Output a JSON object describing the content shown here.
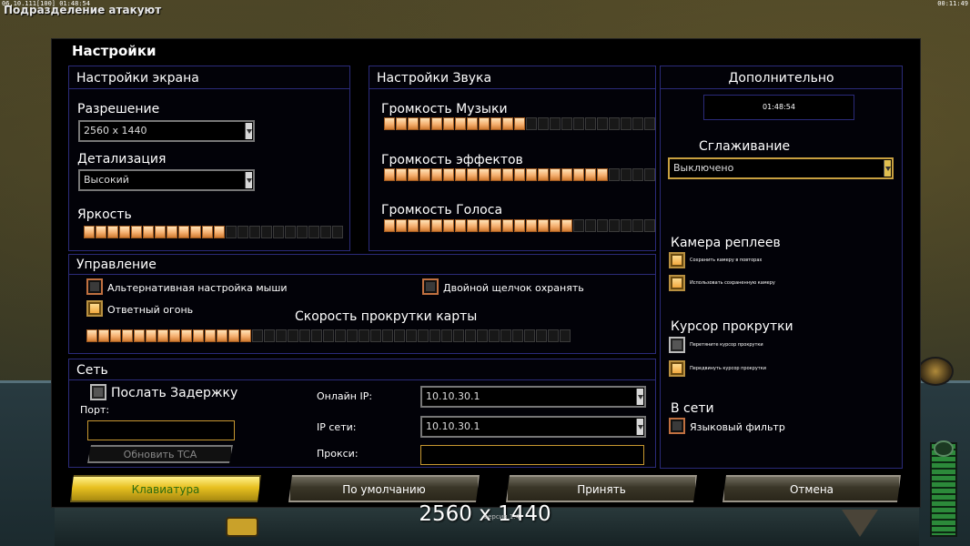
{
  "hud": {
    "top_left_info": "06.10.111[100] 01:48:54",
    "status_message": "Подразделение атакуют",
    "top_right_info": "00:11:49"
  },
  "dialog": {
    "title": "Настройки",
    "screen": {
      "title": "Настройки экрана",
      "resolution_label": "Разрешение",
      "resolution_value": "2560 x 1440",
      "detail_label": "Детализация",
      "detail_value": "Высокий",
      "brightness_label": "Яркость",
      "brightness_level": 12,
      "brightness_segments": 22
    },
    "sound": {
      "title": "Настройки Звука",
      "music_label": "Громкость Музыки",
      "music_level": 12,
      "effects_label": "Громкость эффектов",
      "effects_level": 19,
      "voice_label": "Громкость Голоса",
      "voice_level": 16,
      "segments": 23
    },
    "extra": {
      "title": "Дополнительно",
      "clock": "01:48:54",
      "aa_label": "Сглаживание",
      "aa_value": "Выключено",
      "replay_camera_title": "Камера реплеев",
      "replay_save_camera": "Сохранить камеру в повторах",
      "replay_use_saved_camera": "Использовать сохраненную камеру",
      "scroll_cursor_title": "Курсор прокрутки",
      "scroll_cursor_option1": "Перетяните курсор прокрутки",
      "scroll_cursor_option2": "Передвинуть курсор прокрутки",
      "online_title": "В сети",
      "language_filter": "Языковый фильтр"
    },
    "control": {
      "title": "Управление",
      "alt_mouse": "Альтернативная настройка мыши",
      "double_click_guard": "Двойной щелчок охранять",
      "return_fire": "Ответный огонь",
      "scroll_speed_label": "Скорость прокрутки карты",
      "scroll_speed_level": 14,
      "scroll_speed_segments": 41
    },
    "network": {
      "title": "Сеть",
      "send_delay": "Послать Задержку",
      "port_label": "Порт:",
      "port_value": "",
      "update_tca": "Обновить TCA",
      "online_ip_label": "Онлайн IP:",
      "online_ip_value": "10.10.30.1",
      "lan_ip_label": "IP сети:",
      "lan_ip_value": "10.10.30.1",
      "proxy_label": "Прокси:",
      "proxy_value": ""
    },
    "buttons": {
      "keyboard": "Клавиатура",
      "defaults": "По умолчанию",
      "apply": "Принять",
      "cancel": "Отмена"
    }
  },
  "overlay_resolution": "2560 x 1440",
  "version_text": "версия 1.4",
  "colors": {
    "panel_border": "#2b2b7a",
    "slider_on": "#f5b070",
    "accent_gold": "#c8a040",
    "button_active": "#e8c020"
  }
}
